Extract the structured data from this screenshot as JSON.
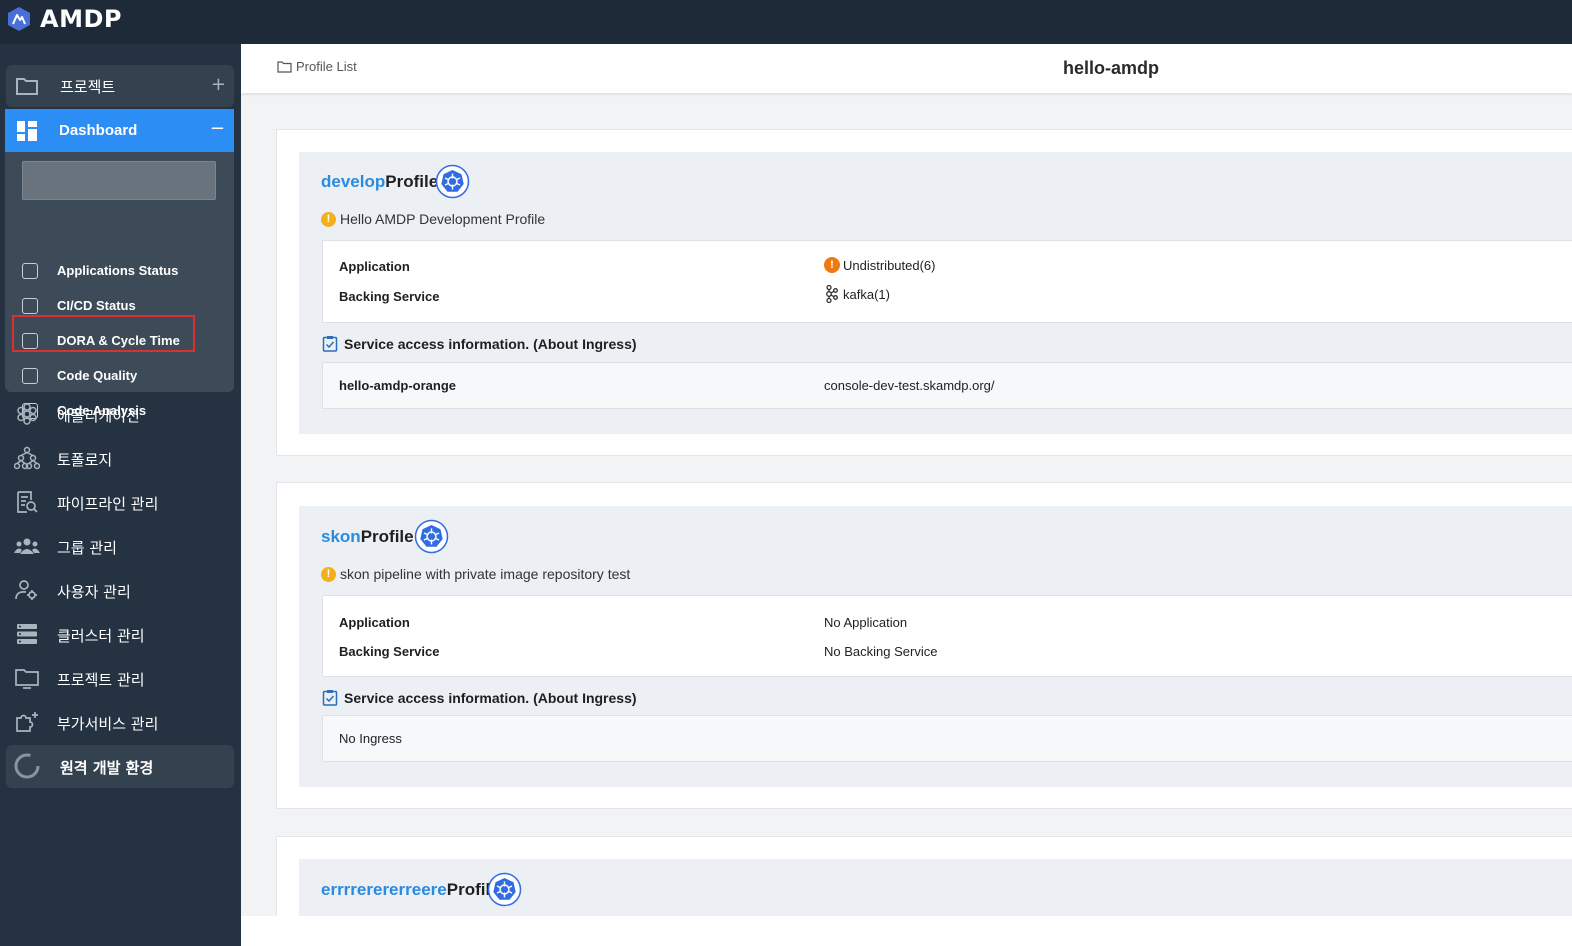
{
  "app": {
    "title": "AMDP"
  },
  "sidebar": {
    "project": {
      "label": "프로젝트",
      "toggle": "+"
    },
    "dashboard": {
      "label": "Dashboard",
      "toggle": "−",
      "search_placeholder": "",
      "items": [
        {
          "label": "Applications Status"
        },
        {
          "label": "CI/CD Status"
        },
        {
          "label": "DORA & Cycle Time"
        },
        {
          "label": "Code Quality"
        },
        {
          "label": "Code Analysis"
        }
      ]
    },
    "nav": [
      {
        "label": "애플리케이션",
        "icon": "application-icon"
      },
      {
        "label": "토폴로지",
        "icon": "topology-icon"
      },
      {
        "label": "파이프라인 관리",
        "icon": "pipeline-icon"
      },
      {
        "label": "그룹 관리",
        "icon": "group-icon"
      },
      {
        "label": "사용자 관리",
        "icon": "user-settings-icon"
      },
      {
        "label": "클러스터 관리",
        "icon": "cluster-icon"
      },
      {
        "label": "프로젝트 관리",
        "icon": "project-monitor-icon"
      },
      {
        "label": "부가서비스 관리",
        "icon": "addon-service-icon"
      }
    ],
    "remote": {
      "label": "원격 개발 환경"
    }
  },
  "header": {
    "breadcrumb": "Profile List",
    "title": "hello-amdp"
  },
  "profiles": [
    {
      "prefix": "develop",
      "suffix": "Profile",
      "description": "Hello AMDP Development Profile",
      "application_label": "Application",
      "application_value": "Undistributed(6)",
      "backing_label": "Backing Service",
      "backing_value": "kafka(1)",
      "service_access_title": "Service access information. (About Ingress)",
      "ingress_name": "hello-amdp-orange",
      "ingress_url": "console-dev-test.skamdp.org/"
    },
    {
      "prefix": "skon",
      "suffix": "Profile",
      "description": "skon pipeline with private image repository test",
      "application_label": "Application",
      "application_value": "No Application",
      "backing_label": "Backing Service",
      "backing_value": "No Backing Service",
      "service_access_title": "Service access information. (About Ingress)",
      "ingress_text": "No Ingress"
    },
    {
      "prefix": "errrrerererreere",
      "suffix": "Profile"
    }
  ],
  "colors": {
    "topbar": "#1e2a38",
    "sidebar": "#253242",
    "accent": "#2c8ef5",
    "warning": "#f3b01a",
    "warning_orange": "#f07a10",
    "k8s_blue": "#326ce5",
    "highlight": "#d93030"
  }
}
